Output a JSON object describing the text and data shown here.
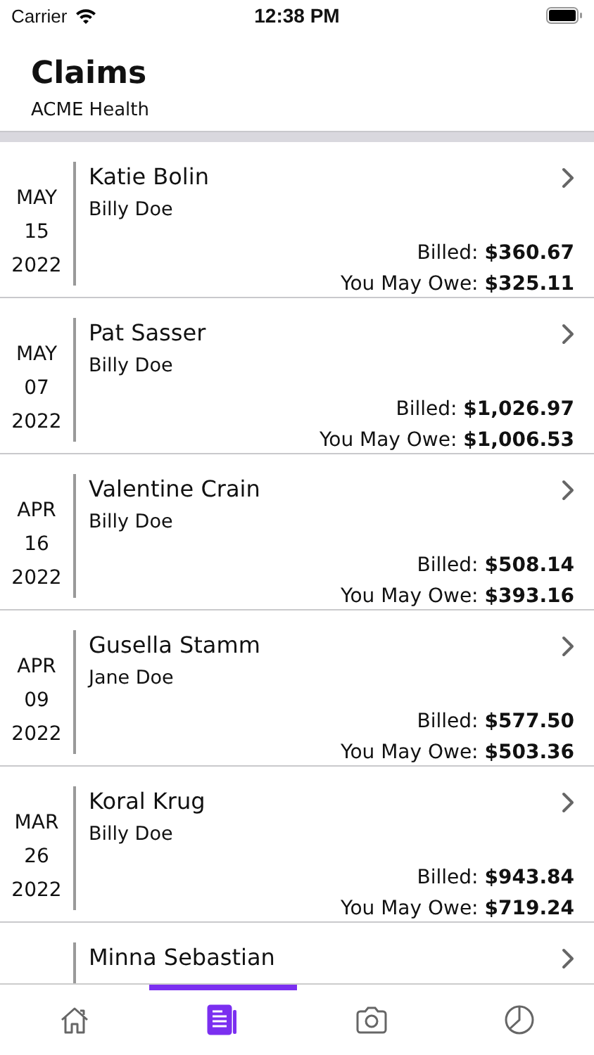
{
  "status_bar": {
    "carrier": "Carrier",
    "time": "12:38 PM"
  },
  "header": {
    "title": "Claims",
    "subtitle": "ACME Health"
  },
  "claims": [
    {
      "month": "MAY",
      "day": "15",
      "year": "2022",
      "provider": "Katie Bolin",
      "patient": "Billy Doe",
      "billed": "Billed: **$360.67**",
      "owe": "You May Owe: **$325.11**"
    },
    {
      "month": "MAY",
      "day": "07",
      "year": "2022",
      "provider": "Pat Sasser",
      "patient": "Billy Doe",
      "billed": "Billed: **$1,026.97**",
      "owe": "You May Owe: **$1,006.53**"
    },
    {
      "month": "APR",
      "day": "16",
      "year": "2022",
      "provider": "Valentine Crain",
      "patient": "Billy Doe",
      "billed": "Billed: **$508.14**",
      "owe": "You May Owe: **$393.16**"
    },
    {
      "month": "APR",
      "day": "09",
      "year": "2022",
      "provider": "Gusella Stamm",
      "patient": "Jane Doe",
      "billed": "Billed: **$577.50**",
      "owe": "You May Owe: **$503.36**"
    },
    {
      "month": "MAR",
      "day": "26",
      "year": "2022",
      "provider": "Koral Krug",
      "patient": "Billy Doe",
      "billed": "Billed: **$943.84**",
      "owe": "You May Owe: **$719.24**"
    },
    {
      "provider": "Minna Sebastian"
    }
  ],
  "tabs": [
    {
      "kind": "home",
      "selected": false
    },
    {
      "kind": "claims",
      "selected": true
    },
    {
      "kind": "camera",
      "selected": false
    },
    {
      "kind": "chart",
      "selected": false
    }
  ]
}
